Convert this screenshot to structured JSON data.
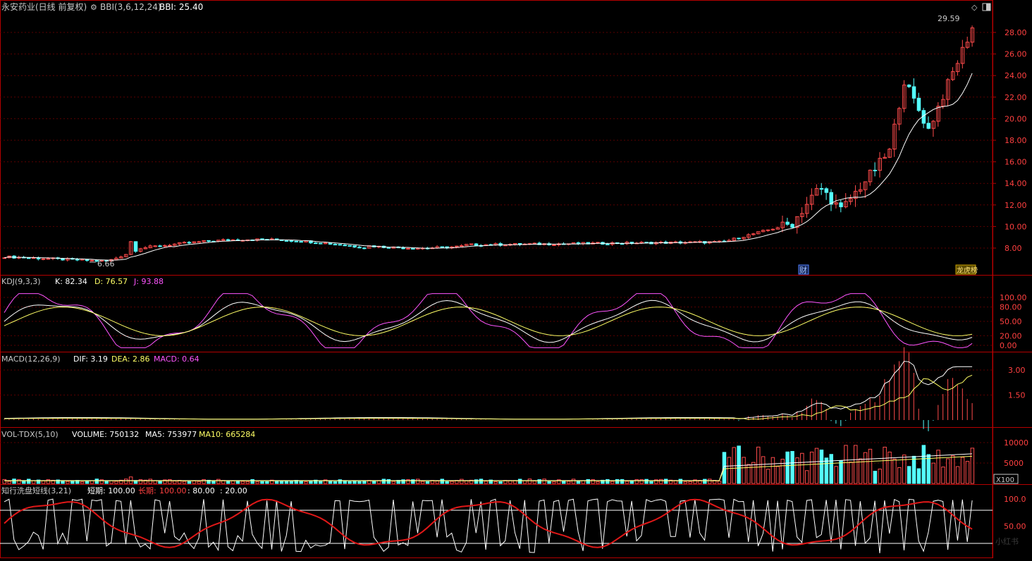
{
  "colors": {
    "background": "#000000",
    "border": "#b40000",
    "grid": "#5a0000",
    "up": "#ff4b4b",
    "down": "#54ffff",
    "white": "#ffffff",
    "yellow": "#ffff66",
    "magenta": "#ff55ff",
    "label": "#c8c8c8",
    "axis_text": "#ff4040"
  },
  "main": {
    "title": "永安药业(日线 前复权)",
    "indicator_name": "BBI(3,6,12,24)",
    "indicator_value": "BBI: 25.40",
    "max_label": "29.59",
    "min_label": "6.66",
    "y_ticks": [
      "28.00",
      "26.00",
      "24.00",
      "22.00",
      "20.00",
      "18.00",
      "16.00",
      "14.00",
      "12.00",
      "10.00",
      "8.00"
    ],
    "event_tags": [
      "财",
      "龙虎榜"
    ]
  },
  "kdj": {
    "name": "KDJ(9,3,3)",
    "k": "K: 82.34",
    "d": "D: 76.57",
    "j": "J: 93.88",
    "y_ticks": [
      "100.00",
      "80.00",
      "50.00",
      "20.00",
      "0.00"
    ]
  },
  "macd": {
    "name": "MACD(12,26,9)",
    "dif": "DIF: 3.19",
    "dea": "DEA: 2.86",
    "macd": "MACD: 0.64",
    "y_ticks": [
      "3.00",
      "1.50"
    ]
  },
  "vol": {
    "name": "VOL-TDX(5,10)",
    "volume": "VOLUME: 750132",
    "ma5": "MA5: 753977",
    "ma10": "MA10: 665284",
    "y_ticks": [
      "10000",
      "5000"
    ],
    "unit": "X100"
  },
  "bottom": {
    "name": "知行洗盘短线(3,21)",
    "short": "短期: 100.00",
    "long_label": "长期:",
    "long_value": "100.00",
    "v80": ": 80.00",
    "v20": ": 20.00",
    "y_ticks": [
      "100.0",
      "50.00"
    ],
    "watermark": "小红书"
  },
  "controls": {
    "expand_icon": "diamond-icon",
    "window_icon": "window-icon"
  }
}
